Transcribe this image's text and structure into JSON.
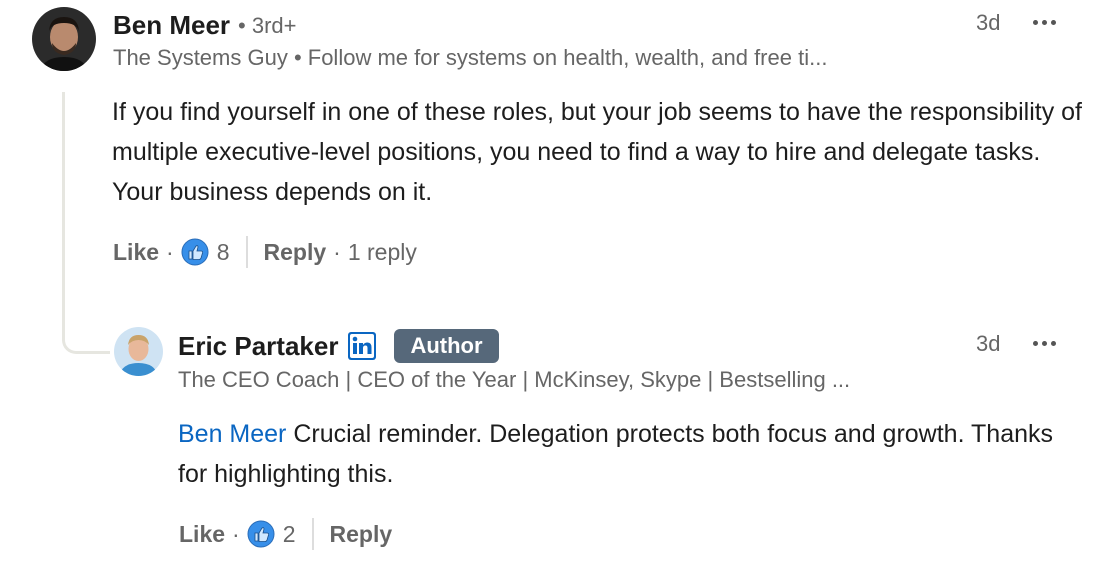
{
  "comment": {
    "author": "Ben Meer",
    "degree": "• 3rd+",
    "headline": "The Systems Guy • Follow me for systems on health, wealth, and free ti...",
    "time": "3d",
    "text": "If you find yourself in one of these roles, but your job seems to have the responsibility of multiple executive-level positions, you need to find a way to hire and delegate tasks. Your business depends on it.",
    "like_label": "Like",
    "reaction_count": "8",
    "reply_label": "Reply",
    "reply_count": "1 reply",
    "avatar_icon": "profile-photo",
    "more_icon": "ellipsis-icon"
  },
  "reply": {
    "author": "Eric Partaker",
    "badge": "Author",
    "headline": "The CEO Coach | CEO of the Year | McKinsey, Skype | Bestselling ...",
    "time": "3d",
    "mention": "Ben Meer",
    "text": " Crucial reminder. Delegation protects both focus and growth. Thanks for highlighting this.",
    "like_label": "Like",
    "reaction_count": "2",
    "reply_label": "Reply",
    "avatar_icon": "profile-photo",
    "linkedin_icon": "linkedin-logo-icon"
  },
  "colors": {
    "link_blue": "#0a66c2",
    "like_blue": "#378fe9",
    "author_badge": "#56687a"
  }
}
